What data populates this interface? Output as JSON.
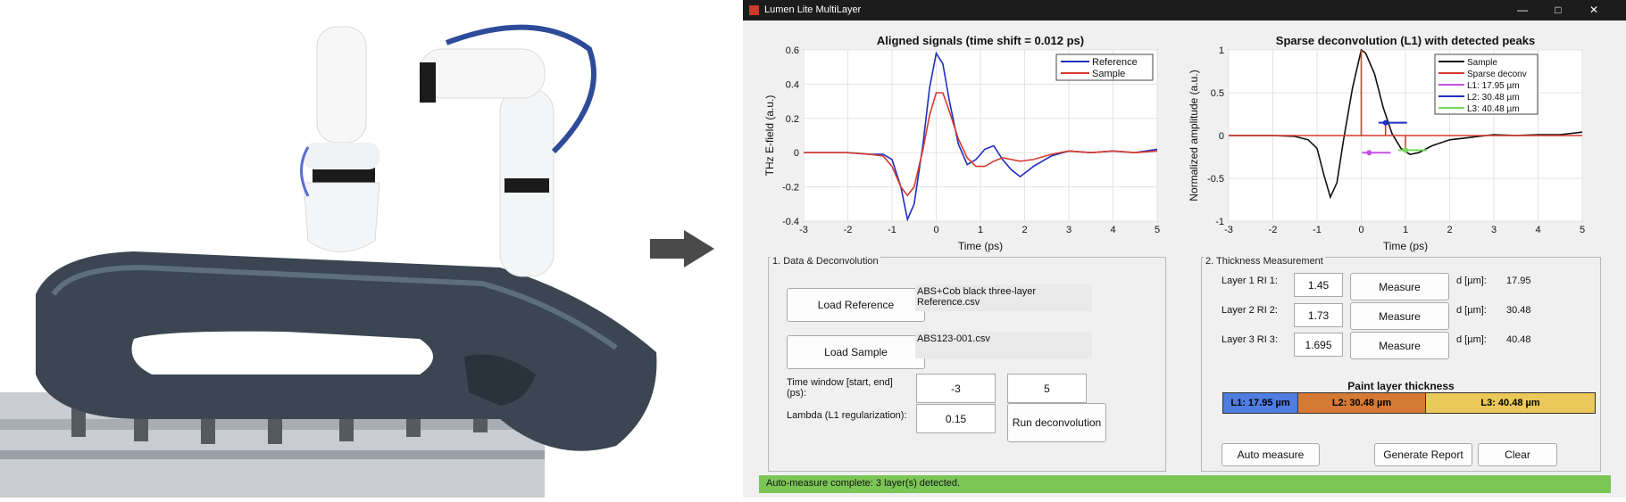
{
  "window": {
    "title": "Lumen Lite MultiLayer",
    "minimize": "—",
    "maximize": "□",
    "close": "✕"
  },
  "colors": {
    "accent_green": "#7cc658",
    "layer1": "#4f7de0",
    "layer2": "#d57a35",
    "layer3": "#ebc858",
    "reference": "#1f2ec4",
    "sample": "#d53a2e"
  },
  "plot1": {
    "title": "Aligned signals (time shift = 0.012 ps)",
    "xlabel": "Time (ps)",
    "ylabel": "THz E-field (a.u.)",
    "xticks": [
      "-3",
      "-2",
      "-1",
      "0",
      "1",
      "2",
      "3",
      "4",
      "5"
    ],
    "yticks": [
      "0.6",
      "0.4",
      "0.2",
      "0",
      "-0.2",
      "-0.4"
    ],
    "legend": [
      "Reference",
      "Sample"
    ]
  },
  "plot2": {
    "title": "Sparse deconvolution (L1) with detected peaks",
    "xlabel": "Time (ps)",
    "ylabel": "Normalized amplitude (a.u.)",
    "xticks": [
      "-3",
      "-2",
      "-1",
      "0",
      "1",
      "2",
      "3",
      "4",
      "5"
    ],
    "yticks": [
      "1",
      "0.5",
      "0",
      "-0.5",
      "-1"
    ],
    "legend": [
      "Sample",
      "Sparse deconv",
      "L1: 17.95 µm",
      "L2: 30.48 µm",
      "L3: 40.48 µm"
    ]
  },
  "chart_data": [
    {
      "type": "line",
      "title": "Aligned signals (time shift = 0.012 ps)",
      "xlabel": "Time (ps)",
      "ylabel": "THz E-field (a.u.)",
      "xlim": [
        -3,
        5
      ],
      "ylim": [
        -0.4,
        0.6
      ],
      "grid": true,
      "legend_position": "top-right",
      "series": [
        {
          "name": "Reference",
          "x": [
            -3,
            -2.5,
            -2,
            -1.5,
            -1.2,
            -1,
            -0.8,
            -0.65,
            -0.5,
            -0.3,
            -0.15,
            0,
            0.15,
            0.3,
            0.5,
            0.7,
            0.9,
            1.1,
            1.3,
            1.5,
            1.7,
            1.9,
            2.2,
            2.6,
            3,
            3.5,
            4,
            4.5,
            5
          ],
          "y": [
            0,
            0,
            0,
            -0.01,
            -0.01,
            -0.04,
            -0.2,
            -0.39,
            -0.3,
            0.05,
            0.38,
            0.58,
            0.52,
            0.3,
            0.05,
            -0.07,
            -0.04,
            0.02,
            0.04,
            -0.04,
            -0.1,
            -0.14,
            -0.08,
            -0.02,
            0.01,
            0,
            0.01,
            0,
            0.02
          ]
        },
        {
          "name": "Sample",
          "x": [
            -3,
            -2.5,
            -2,
            -1.5,
            -1.2,
            -1,
            -0.8,
            -0.65,
            -0.5,
            -0.3,
            -0.15,
            0,
            0.15,
            0.3,
            0.5,
            0.7,
            0.9,
            1.1,
            1.3,
            1.5,
            1.7,
            1.9,
            2.2,
            2.6,
            3,
            3.5,
            4,
            4.5,
            5
          ],
          "y": [
            0,
            0,
            0,
            -0.01,
            -0.02,
            -0.08,
            -0.2,
            -0.25,
            -0.2,
            0.02,
            0.22,
            0.35,
            0.35,
            0.24,
            0.08,
            -0.03,
            -0.08,
            -0.08,
            -0.05,
            -0.03,
            -0.04,
            -0.05,
            -0.04,
            -0.01,
            0.01,
            0,
            0.01,
            0,
            0.01
          ]
        }
      ]
    },
    {
      "type": "line",
      "title": "Sparse deconvolution (L1) with detected peaks",
      "xlabel": "Time (ps)",
      "ylabel": "Normalized amplitude (a.u.)",
      "xlim": [
        -3,
        5
      ],
      "ylim": [
        -1,
        1
      ],
      "grid": true,
      "legend_position": "top-right",
      "series": [
        {
          "name": "Sample",
          "x": [
            -3,
            -2.5,
            -2,
            -1.5,
            -1.2,
            -1,
            -0.85,
            -0.7,
            -0.55,
            -0.4,
            -0.2,
            0,
            0.1,
            0.3,
            0.5,
            0.7,
            0.9,
            1.1,
            1.3,
            1.6,
            2,
            2.5,
            3,
            3.5,
            4,
            4.5,
            5
          ],
          "y": [
            0,
            0,
            0,
            -0.01,
            -0.05,
            -0.15,
            -0.45,
            -0.72,
            -0.55,
            -0.05,
            0.55,
            1,
            0.96,
            0.72,
            0.32,
            0.02,
            -0.15,
            -0.22,
            -0.2,
            -0.12,
            -0.05,
            -0.02,
            0.01,
            0,
            0.01,
            0.01,
            0.04
          ]
        },
        {
          "name": "Sparse deconv",
          "x": [
            -3,
            0,
            0,
            0,
            0.55,
            0.55,
            0.55,
            1,
            1,
            1,
            5
          ],
          "y": [
            0,
            0,
            1,
            0,
            0,
            0.15,
            0,
            0,
            -0.17,
            0,
            0
          ]
        },
        {
          "name": "L1: 17.95 µm",
          "x": [
            0.18
          ],
          "y": [
            -0.2
          ]
        },
        {
          "name": "L2: 30.48 µm",
          "x": [
            0.55
          ],
          "y": [
            0.15
          ]
        },
        {
          "name": "L3: 40.48 µm",
          "x": [
            1.0
          ],
          "y": [
            -0.17
          ]
        }
      ]
    }
  ],
  "data_panel": {
    "title": "1. Data & Deconvolution",
    "load_reference": "Load Reference",
    "reference_file": "ABS+Cob black three-layer Reference.csv",
    "load_sample": "Load Sample",
    "sample_file": "ABS123-001.csv",
    "time_window_label": "Time window [start, end] (ps):",
    "time_start": "-3",
    "time_end": "5",
    "lambda_label": "Lambda (L1 regularization):",
    "lambda": "0.15",
    "run": "Run deconvolution"
  },
  "thickness_panel": {
    "title": "2. Thickness Measurement",
    "layers": [
      {
        "label": "Layer 1 RI 1:",
        "ri": "1.45",
        "measure": "Measure",
        "d_label": "d [µm]:",
        "d": "17.95"
      },
      {
        "label": "Layer 2 RI 2:",
        "ri": "1.73",
        "measure": "Measure",
        "d_label": "d [µm]:",
        "d": "30.48"
      },
      {
        "label": "Layer 3 RI 3:",
        "ri": "1.695",
        "measure": "Measure",
        "d_label": "d [µm]:",
        "d": "40.48"
      }
    ],
    "paint_title": "Paint layer thickness",
    "bar": [
      "L1: 17.95 µm",
      "L2: 30.48 µm",
      "L3: 40.48 µm"
    ],
    "auto_measure": "Auto measure",
    "generate_report": "Generate Report",
    "clear": "Clear"
  },
  "status": "Auto-measure complete: 3 layer(s) detected."
}
